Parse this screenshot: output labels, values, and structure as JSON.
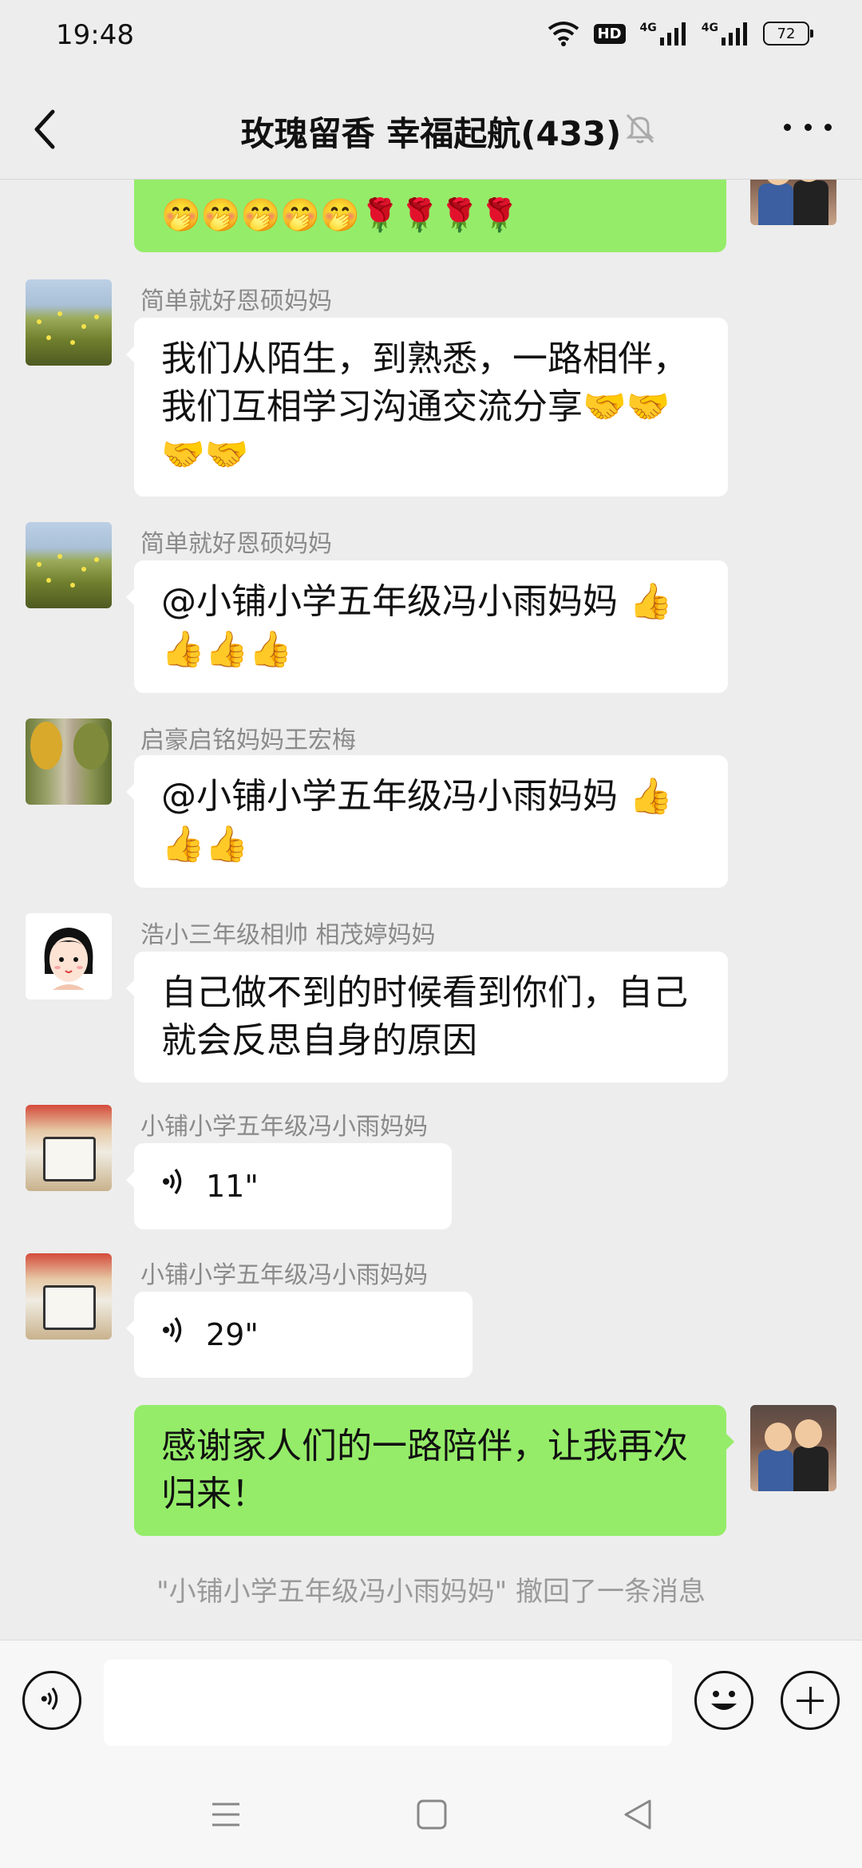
{
  "status_bar": {
    "time": "19:48",
    "hd": "HD",
    "network_1": "4G",
    "network_2": "4G",
    "battery": "72"
  },
  "chat": {
    "title": "玫瑰留香  幸福起航(433)"
  },
  "colors": {
    "self_bubble": "#95ec69",
    "other_bubble": "#ffffff",
    "background": "#ededed"
  },
  "messages": [
    {
      "type": "text",
      "direction": "outgoing",
      "text": "🤭🤭🤭🤭🤭🌹🌹🌹🌹",
      "avatar": "kids-photo"
    },
    {
      "type": "text",
      "direction": "incoming",
      "sender": "简单就好恩硕妈妈",
      "text": "我们从陌生，到熟悉，一路相伴，我们互相学习沟通交流分享🤝🤝🤝🤝",
      "avatar": "wheat-field"
    },
    {
      "type": "text",
      "direction": "incoming",
      "sender": "简单就好恩硕妈妈",
      "text": "@小铺小学五年级冯小雨妈妈 👍👍👍👍",
      "avatar": "wheat-field"
    },
    {
      "type": "text",
      "direction": "incoming",
      "sender": "启豪启铭妈妈王宏梅",
      "text": "@小铺小学五年级冯小雨妈妈 👍👍👍",
      "avatar": "tree-road"
    },
    {
      "type": "text",
      "direction": "incoming",
      "sender": "浩小三年级相帅 相茂婷妈妈",
      "text": "自己做不到的时候看到你们，自己就会反思自身的原因",
      "avatar": "cartoon-girl"
    },
    {
      "type": "voice",
      "direction": "incoming",
      "sender": "小铺小学五年级冯小雨妈妈",
      "duration": "11\"",
      "avatar": "piano-stage"
    },
    {
      "type": "voice",
      "direction": "incoming",
      "sender": "小铺小学五年级冯小雨妈妈",
      "duration": "29\"",
      "avatar": "piano-stage"
    },
    {
      "type": "text",
      "direction": "outgoing",
      "text": "感谢家人们的一路陪伴，让我再次归来！",
      "avatar": "kids-photo"
    }
  ],
  "recall_notice": "\"小铺小学五年级冯小雨妈妈\" 撤回了一条消息",
  "input": {
    "value": ""
  },
  "icons": {
    "back": "chevron-left-icon",
    "mute": "bell-off-icon",
    "more": "more-dots-icon",
    "voice": "voice-wave-icon",
    "emoji": "smiley-icon",
    "plus": "plus-icon",
    "nav_menu": "menu-icon",
    "nav_home": "square-icon",
    "nav_back": "triangle-back-icon"
  }
}
